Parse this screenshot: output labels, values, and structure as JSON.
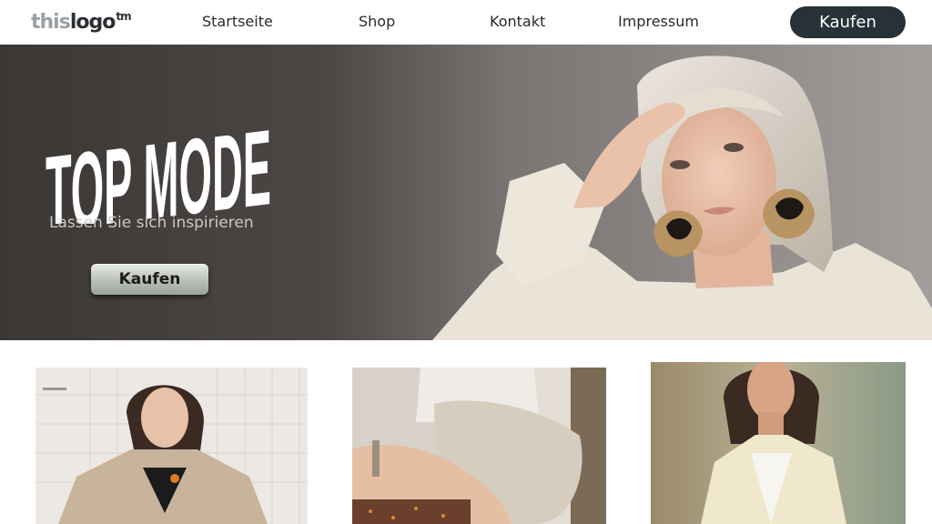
{
  "header": {
    "logo": {
      "this": "this",
      "logo": "logo",
      "tm": "tm"
    },
    "nav": [
      "Startseite",
      "Shop",
      "Kontakt",
      "Impressum"
    ],
    "buy_label": "Kaufen"
  },
  "hero": {
    "title": "TOP MODE",
    "subtitle": "Lassen Sie sich inspirieren",
    "buy_label": "Kaufen"
  },
  "products": [
    {
      "image": "woman-beige-blazer-photo"
    },
    {
      "image": "hands-knit-sweater-photo"
    },
    {
      "image": "woman-cream-blazer-photo"
    }
  ],
  "colors": {
    "header_button_bg": "#263238",
    "hero_bg_dark": "#3a3634",
    "hero_bg_light": "#9a9694",
    "hero_subtitle": "#c9c9c9"
  }
}
